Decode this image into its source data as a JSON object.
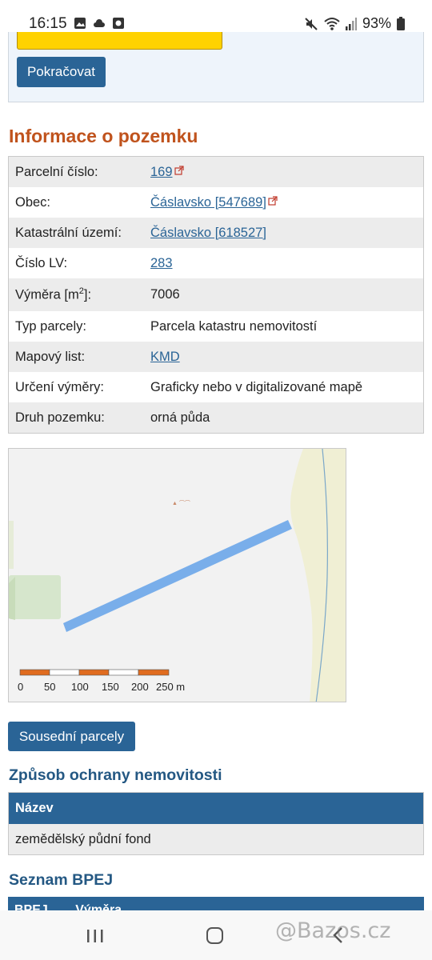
{
  "status_bar": {
    "time": "16:15",
    "battery": "93%",
    "left_icons": [
      "image-icon",
      "cloud-icon",
      "app-icon"
    ],
    "right_icons": [
      "mute-icon",
      "wifi-icon",
      "signal-icon",
      "battery-icon"
    ]
  },
  "top_box": {
    "continue_label": "Pokračovat"
  },
  "info": {
    "title": "Informace o pozemku",
    "rows": [
      {
        "key": "Parcelní číslo:",
        "value": "169"
      },
      {
        "key": "Obec:",
        "value": "Čáslavsko [547689]"
      },
      {
        "key": "Katastrální území:",
        "value": "Čáslavsko [618527]"
      },
      {
        "key": "Číslo LV:",
        "value": "283"
      },
      {
        "key": "Výměra [m",
        "key_sup": "2",
        "key_after": "]:",
        "value": "7006"
      },
      {
        "key": "Typ parcely:",
        "value": "Parcela katastru nemovitostí"
      },
      {
        "key": "Mapový list:",
        "value": "KMD"
      },
      {
        "key": "Určení výměry:",
        "value": "Graficky nebo v digitalizované mapě"
      },
      {
        "key": "Druh pozemku:",
        "value": "orná půda"
      }
    ]
  },
  "map": {
    "scale_labels": [
      "0",
      "50",
      "100",
      "150",
      "200",
      "250 m"
    ],
    "parcel_color": "#79aeea",
    "scale_color": "#e06c1f"
  },
  "neighbors_button": "Sousední parcely",
  "protection": {
    "title": "Způsob ochrany nemovitosti",
    "header": "Název",
    "value": "zemědělský půdní fond"
  },
  "bpej": {
    "title": "Seznam BPEJ",
    "headers": [
      "BPEJ",
      "Výměra"
    ]
  },
  "watermark": "@Bazos.cz",
  "colors": {
    "accent": "#2a6496",
    "heading_orange": "#c0531d",
    "heading_blue": "#245883",
    "yellow": "#ffd200"
  }
}
